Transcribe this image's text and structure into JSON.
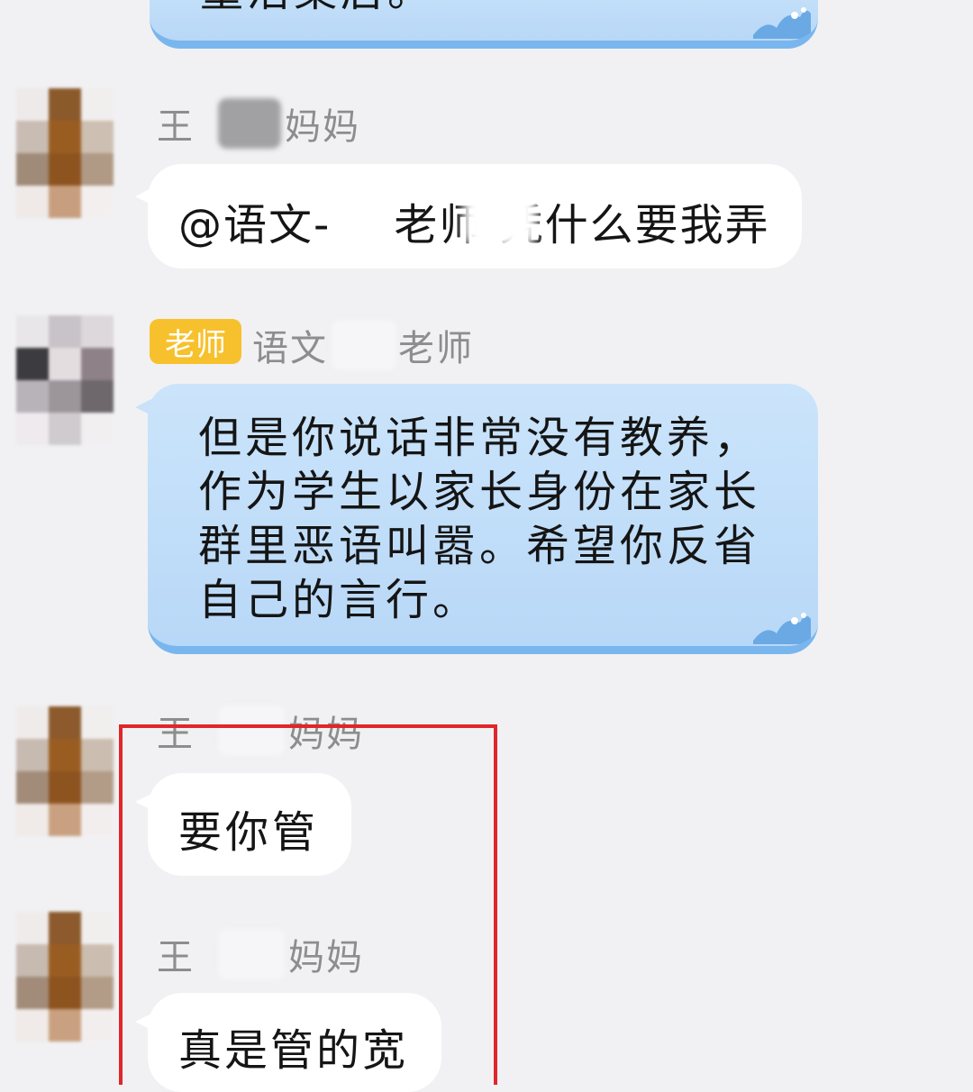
{
  "top_bubble": {
    "text": "童活案居。"
  },
  "messages": [
    {
      "sender_prefix": "王",
      "sender_suffix": "妈妈",
      "text_before": "@语文-",
      "text_after": "老师 凭什么要我弄"
    },
    {
      "badge": "老师",
      "sender_prefix": "语文",
      "sender_suffix": "老师",
      "lines": [
        "但是你说话非常没有教养，",
        "作为学生以家长身份在家长",
        "群里恶语叫嚣。希望你反省",
        "自己的言行。"
      ]
    },
    {
      "sender_prefix": "王",
      "sender_suffix": "妈妈",
      "text": "要你管"
    },
    {
      "sender_prefix": "王",
      "sender_suffix": "妈妈",
      "text": "真是管的宽"
    }
  ],
  "colors": {
    "highlight": "#e0262b",
    "badge": "#f7c12d",
    "blue_bubble": "#c9e2fa"
  }
}
